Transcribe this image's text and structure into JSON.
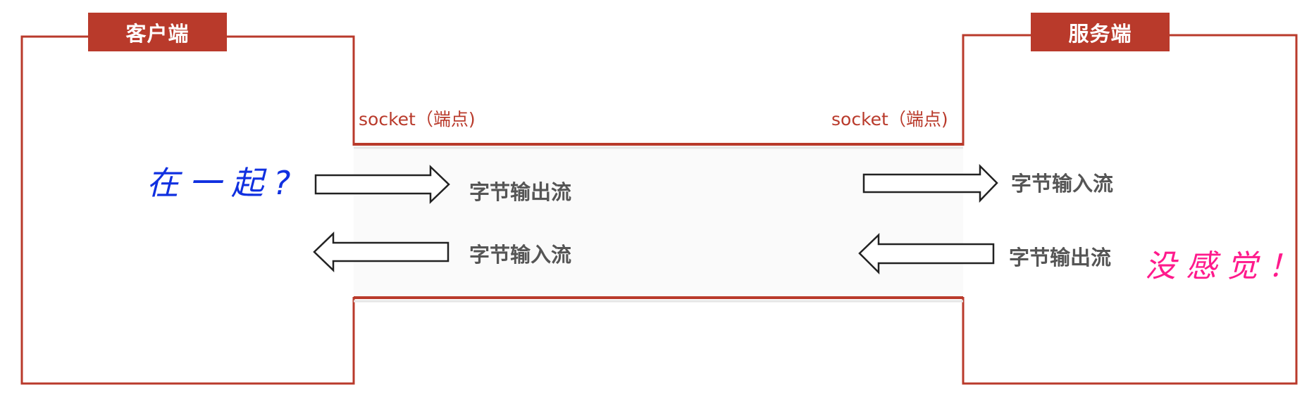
{
  "client": {
    "label": "客户端"
  },
  "server": {
    "label": "服务端"
  },
  "sockets": {
    "left_label": "socket（端点)",
    "right_label": "socket（端点)"
  },
  "streams": {
    "client_output": "字节输出流",
    "client_input": "字节输入流",
    "server_input": "字节输入流",
    "server_output": "字节输出流"
  },
  "annotations": {
    "client_note": "在一起?",
    "server_note": "没感觉！"
  },
  "colors": {
    "frame": "#b93a2b",
    "stream_text": "#555555",
    "client_note": "#1030e0",
    "server_note": "#ff1a8c"
  }
}
